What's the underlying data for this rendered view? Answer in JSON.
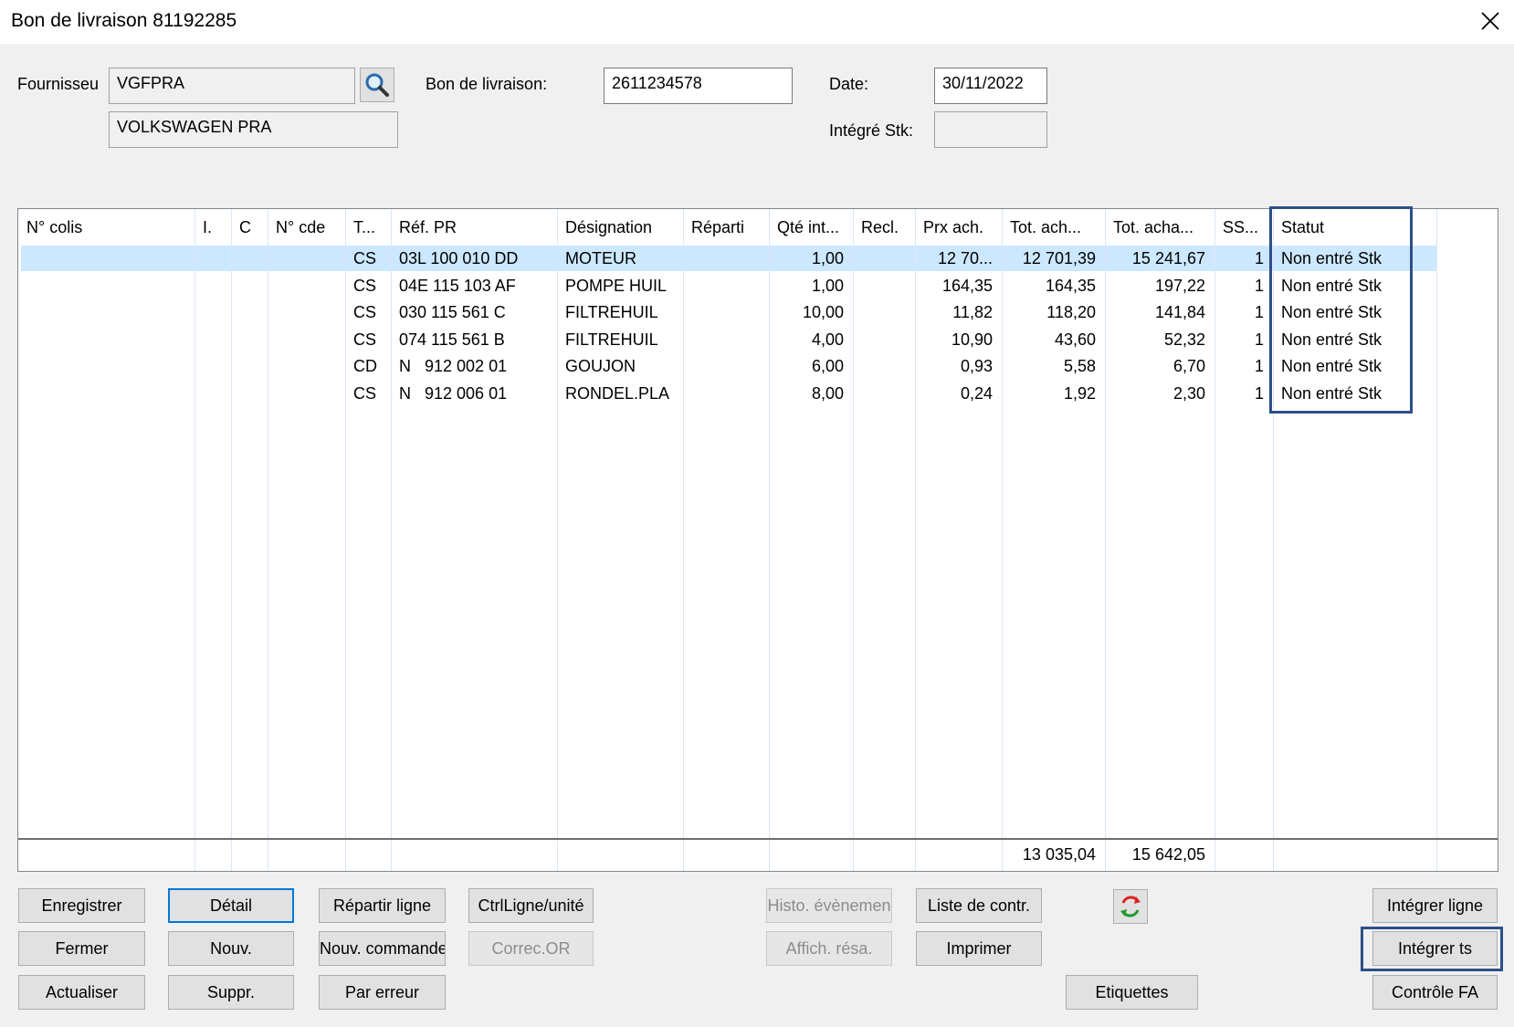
{
  "window": {
    "title": "Bon de livraison 81192285"
  },
  "header": {
    "fournisseur_label": "Fournisseu",
    "fournisseur_code": "VGFPRA",
    "fournisseur_name": "VOLKSWAGEN PRA",
    "bon_label": "Bon de livraison:",
    "bon_value": "2611234578",
    "date_label": "Date:",
    "date_value": "30/11/2022",
    "integre_label": "Intégré Stk:",
    "integre_value": ""
  },
  "table": {
    "columns": [
      "N° colis",
      "I.",
      "C",
      "N° cde",
      "T...",
      "Réf. PR",
      "Désignation",
      "Réparti",
      "Qté int...",
      "Recl.",
      "Prx ach.",
      "Tot. ach...",
      "Tot. acha...",
      "SS...",
      "Statut"
    ],
    "rows": [
      [
        "",
        "",
        "",
        "",
        "CS",
        "03L 100 010 DD",
        "MOTEUR",
        "",
        "1,00",
        "",
        "12 70...",
        "12 701,39",
        "15 241,67",
        "1",
        "Non entré Stk"
      ],
      [
        "",
        "",
        "",
        "",
        "CS",
        "04E 115 103 AF",
        "POMPE HUIL",
        "",
        "1,00",
        "",
        "164,35",
        "164,35",
        "197,22",
        "1",
        "Non entré Stk"
      ],
      [
        "",
        "",
        "",
        "",
        "CS",
        "030 115 561 C",
        "FILTREHUIL",
        "",
        "10,00",
        "",
        "11,82",
        "118,20",
        "141,84",
        "1",
        "Non entré Stk"
      ],
      [
        "",
        "",
        "",
        "",
        "CS",
        "074 115 561 B",
        "FILTREHUIL",
        "",
        "4,00",
        "",
        "10,90",
        "43,60",
        "52,32",
        "1",
        "Non entré Stk"
      ],
      [
        "",
        "",
        "",
        "",
        "CD",
        "N   912 002 01",
        "GOUJON",
        "",
        "6,00",
        "",
        "0,93",
        "5,58",
        "6,70",
        "1",
        "Non entré Stk"
      ],
      [
        "",
        "",
        "",
        "",
        "CS",
        "N   912 006 01",
        "RONDEL.PLA",
        "",
        "8,00",
        "",
        "0,24",
        "1,92",
        "2,30",
        "1",
        "Non entré Stk"
      ]
    ],
    "totals": {
      "tot_ach": "13 035,04",
      "tot_acha": "15 642,05"
    }
  },
  "buttons": {
    "enregistrer": "Enregistrer",
    "detail": "Détail",
    "repartir": "Répartir ligne",
    "ctrlligne": "CtrlLigne/unité",
    "histo": "Histo. évènemen",
    "liste": "Liste de contr.",
    "integrer_ligne": "Intégrer ligne",
    "fermer": "Fermer",
    "nouv": "Nouv.",
    "nouv_commande": "Nouv. commande",
    "correc": "Correc.OR",
    "affich": "Affich. résa.",
    "imprimer": "Imprimer",
    "integrer_ts": "Intégrer ts",
    "actualiser": "Actualiser",
    "suppr": "Suppr.",
    "par_erreur": "Par erreur",
    "etiquettes": "Etiquettes",
    "controle_fa": "Contrôle FA"
  },
  "icons": {
    "search": "search-icon",
    "refresh": "refresh-icon",
    "close": "close-icon"
  },
  "colors": {
    "selection": "#cce8ff",
    "highlight_box": "#2e4f87",
    "focus": "#0078d7"
  }
}
